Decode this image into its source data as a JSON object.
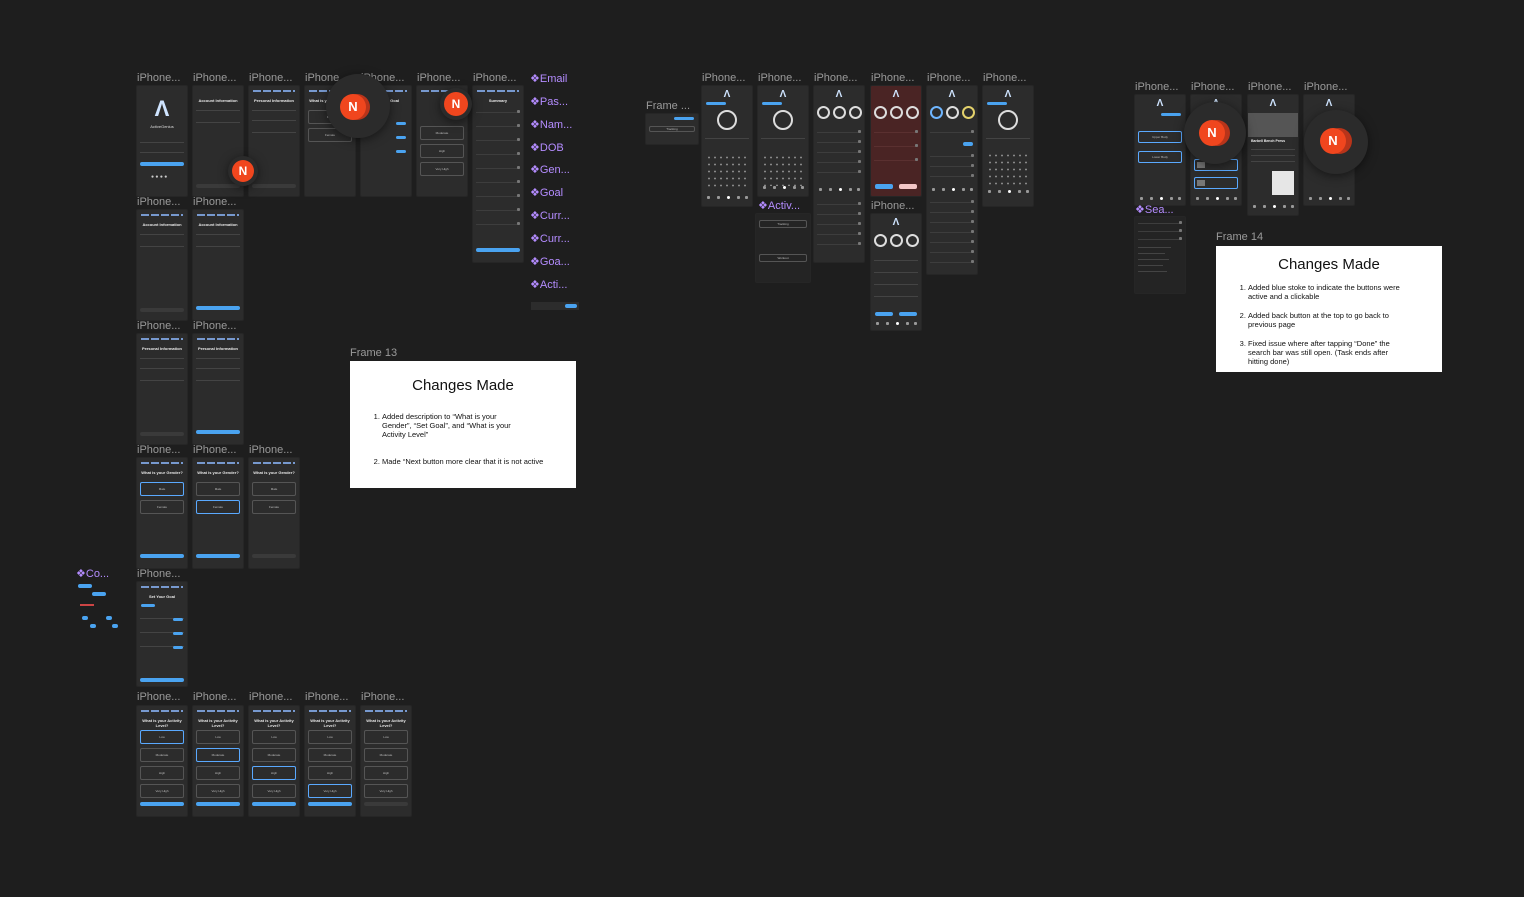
{
  "canvas": {
    "background": "#1e1e1e",
    "accent": "#4aa3f0",
    "component_color": "#b48cff"
  },
  "frame_labels": {
    "iphone": "iPhone...",
    "frame_short": "Frame ...",
    "frame13": "Frame 13",
    "frame14": "Frame 14"
  },
  "component_labels": {
    "email": "Email",
    "password": "Pas...",
    "name": "Nam...",
    "dob": "DOB",
    "gender": "Gen...",
    "goal": "Goal",
    "current1": "Curr...",
    "current2": "Curr...",
    "goal2": "Goa...",
    "activity": "Acti...",
    "activ": "Activ...",
    "co": "Co...",
    "search": "Sea..."
  },
  "phones": {
    "login_title": "ActiveGenius",
    "account_info": "Account Information",
    "personal_info": "Personal Information",
    "what_gender": "What is your Gender?",
    "set_goal": "Set Your Goal",
    "activity_level": "What is your Activity Level?",
    "summary": "Summary",
    "options_gender": [
      "Male",
      "Female"
    ],
    "options_activity": [
      "Low",
      "Moderate",
      "High",
      "Very High"
    ],
    "upper_body": "Upper Body",
    "lower_body": "Lower Body",
    "barbell_bench": "Barbell Bench Press",
    "tracking": "Tracking",
    "workout": "Workout"
  },
  "avatar": {
    "letter": "N",
    "color": "#f0461e"
  },
  "note13": {
    "title": "Changes Made",
    "items": [
      "Added description to “What is your Gender”, “Set Goal”, and “What is your Activity Level”",
      "Made “Next button more clear that it is not active"
    ]
  },
  "note14": {
    "title": "Changes Made",
    "items": [
      "Added blue stoke to indicate the buttons were active and a clickable",
      "Added back button at the top to go back to previous page",
      "Fixed issue where after tapping “Done” the search bar was still open. (Task ends after hitting done)"
    ]
  }
}
